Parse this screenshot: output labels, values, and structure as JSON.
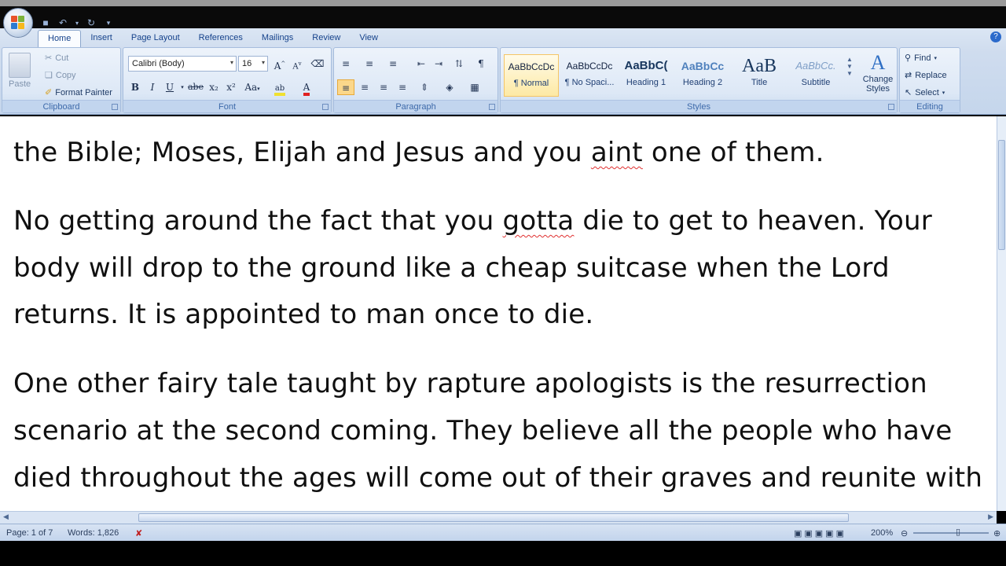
{
  "quick_access": {
    "icons": [
      "save-icon",
      "undo-icon",
      "redo-icon",
      "customize-icon"
    ]
  },
  "ribbon": {
    "tabs": [
      "Home",
      "Insert",
      "Page Layout",
      "References",
      "Mailings",
      "Review",
      "View"
    ],
    "active_tab": "Home",
    "clipboard": {
      "label": "Clipboard",
      "paste": "Paste",
      "cut": "Cut",
      "copy": "Copy",
      "format_painter": "Format Painter"
    },
    "font": {
      "label": "Font",
      "font_name": "Calibri (Body)",
      "font_size": "16",
      "bold": "B",
      "italic": "I",
      "underline": "U",
      "strike": "abe",
      "subscript": "x₂",
      "superscript": "x²",
      "change_case": "Aa",
      "grow": "A",
      "shrink": "A"
    },
    "paragraph": {
      "label": "Paragraph"
    },
    "styles": {
      "label": "Styles",
      "items": [
        {
          "sample": "AaBbCcDc",
          "name": "¶ Normal"
        },
        {
          "sample": "AaBbCcDc",
          "name": "¶ No Spaci..."
        },
        {
          "sample": "AaBbC(",
          "name": "Heading 1"
        },
        {
          "sample": "AaBbCc",
          "name": "Heading 2"
        },
        {
          "sample": "AaB",
          "name": "Title"
        },
        {
          "sample": "AaBbCc.",
          "name": "Subtitle"
        }
      ],
      "change_styles": "Change Styles"
    },
    "editing": {
      "label": "Editing",
      "find": "Find",
      "replace": "Replace",
      "select": "Select"
    }
  },
  "document": {
    "lines": [
      "the Bible; Moses, Elijah and Jesus and you aint one of them.",
      "No getting around the fact that you gotta die to get to heaven. Your",
      "body will drop to the ground like a cheap suitcase when the Lord",
      "returns. It is appointed to man once to die.",
      "One other fairy tale taught by rapture apologists is the resurrection",
      "scenario at the second coming. They believe all the people who have",
      "died throughout the ages will come out of their graves and reunite with"
    ],
    "misspelled": [
      "aint",
      "gotta"
    ]
  },
  "status_bar": {
    "page": "Page: 1 of 7",
    "words": "Words: 1,826",
    "zoom": "200%"
  },
  "colors": {
    "ribbon_blue": "#c5d6ec",
    "tab_text": "#15428b",
    "highlight": "#f0e030",
    "font_color": "#e02020"
  }
}
